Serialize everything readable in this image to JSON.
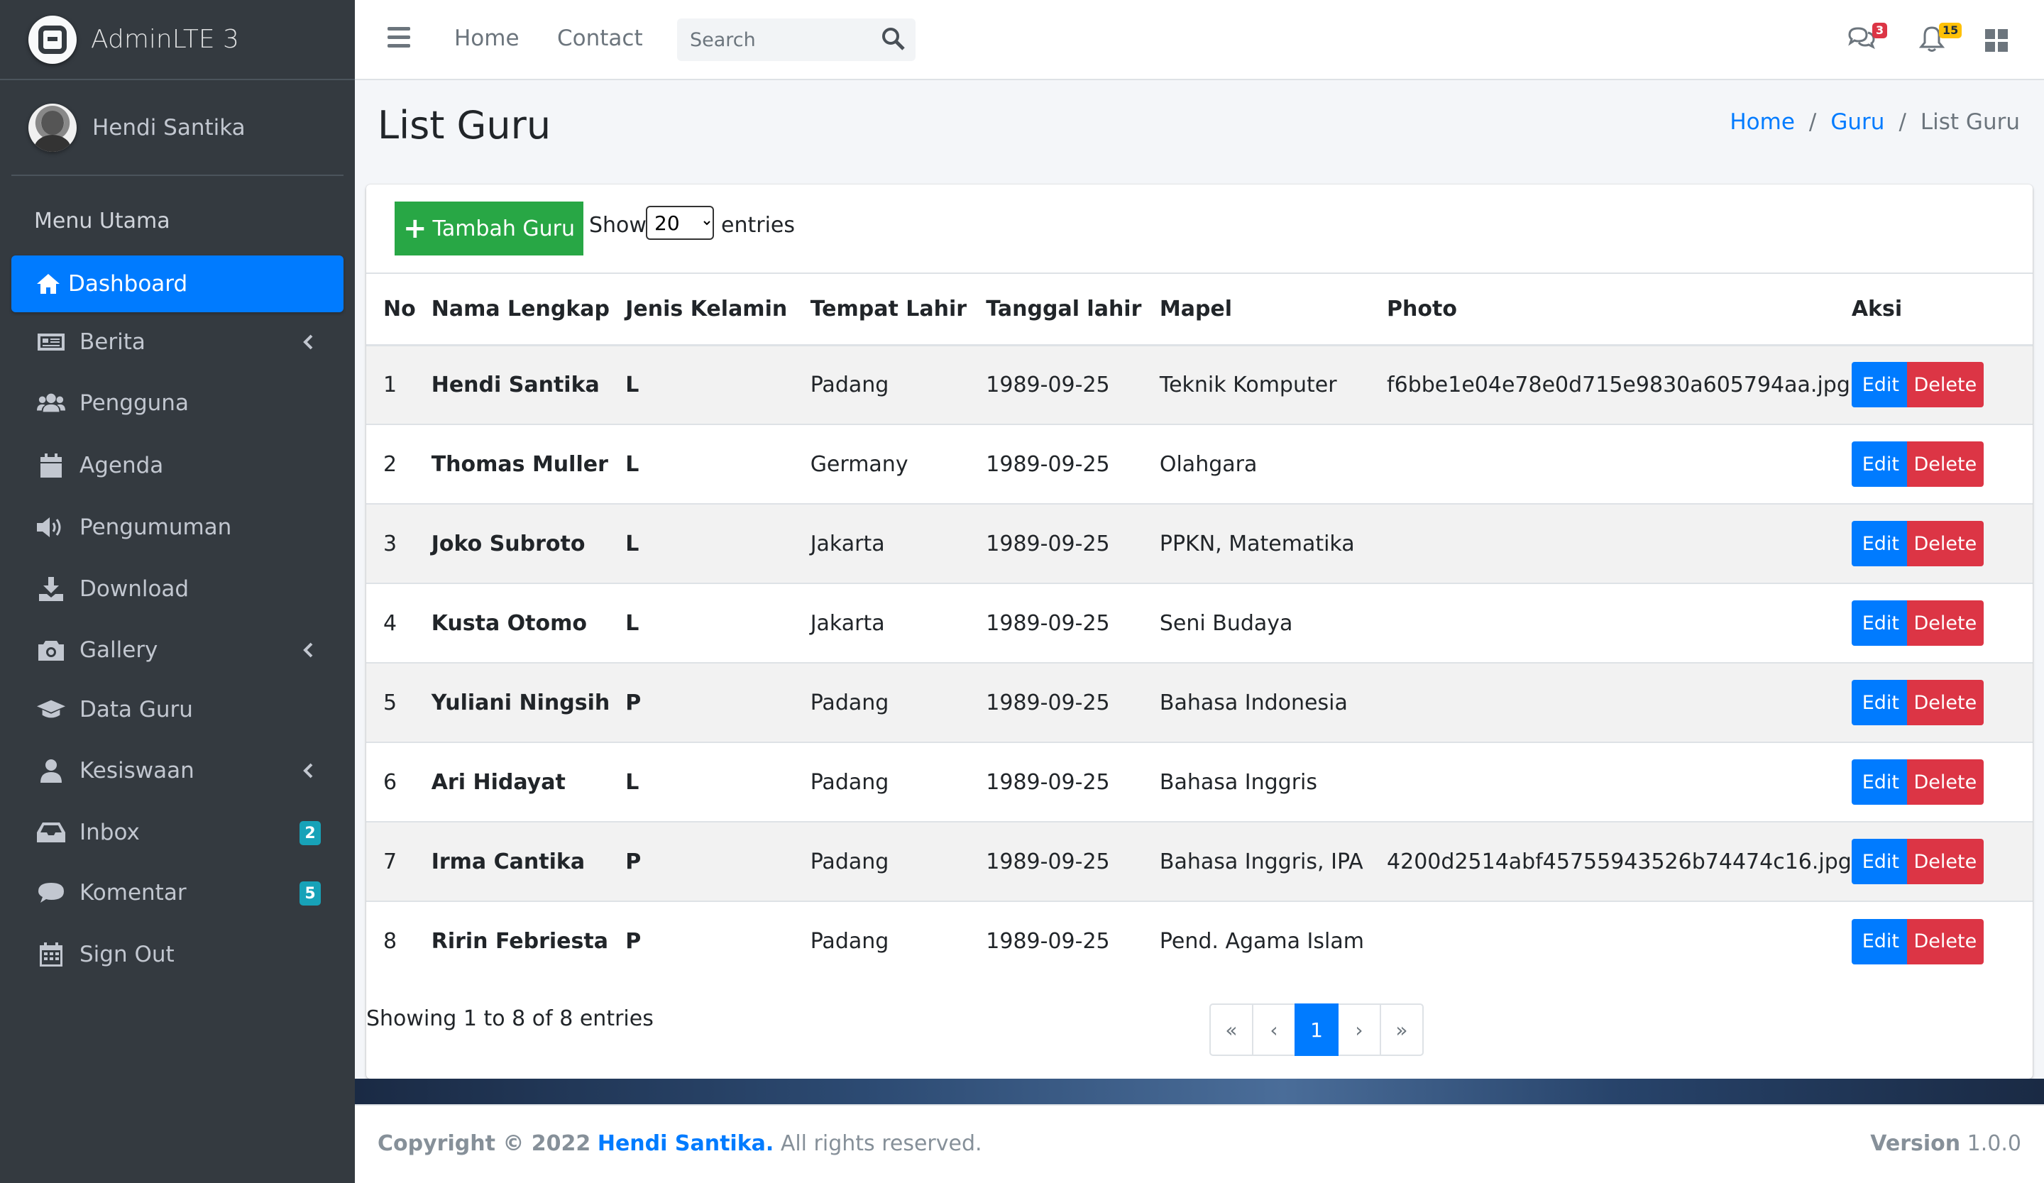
{
  "brand": {
    "name": "AdminLTE 3"
  },
  "user": {
    "name": "Hendi Santika"
  },
  "sidebar": {
    "header": "Menu Utama",
    "items": [
      {
        "label": "Dashboard",
        "icon": "home-icon"
      },
      {
        "label": "Berita",
        "icon": "newspaper-icon"
      },
      {
        "label": "Pengguna",
        "icon": "users-icon"
      },
      {
        "label": "Agenda",
        "icon": "calendar-icon"
      },
      {
        "label": "Pengumuman",
        "icon": "volume-icon"
      },
      {
        "label": "Download",
        "icon": "download-icon"
      },
      {
        "label": "Gallery",
        "icon": "camera-icon"
      },
      {
        "label": "Data Guru",
        "icon": "graduation-cap-icon"
      },
      {
        "label": "Kesiswaan",
        "icon": "user-icon"
      },
      {
        "label": "Inbox",
        "icon": "inbox-icon",
        "badge": "2"
      },
      {
        "label": "Komentar",
        "icon": "comment-icon",
        "badge": "5"
      },
      {
        "label": "Sign Out",
        "icon": "calendar-grid-icon"
      }
    ]
  },
  "topbar": {
    "home": "Home",
    "contact": "Contact",
    "search_placeholder": "Search",
    "messages_badge": "3",
    "notifications_badge": "15"
  },
  "page": {
    "title": "List Guru",
    "breadcrumb": [
      "Home",
      "Guru",
      "List Guru"
    ]
  },
  "card": {
    "add_button": "Tambah Guru",
    "show_label": "Show",
    "show_value": "20",
    "entries_label": "entries",
    "columns": [
      "No",
      "Nama Lengkap",
      "Jenis Kelamin",
      "Tempat Lahir",
      "Tanggal lahir",
      "Mapel",
      "Photo",
      "Aksi"
    ],
    "rows": [
      [
        "1",
        "Hendi Santika",
        "L",
        "Padang",
        "1989-09-25",
        "Teknik Komputer",
        "f6bbe1e04e78e0d715e9830a605794aa.jpg"
      ],
      [
        "2",
        "Thomas Muller",
        "L",
        "Germany",
        "1989-09-25",
        "Olahgara",
        ""
      ],
      [
        "3",
        "Joko Subroto",
        "L",
        "Jakarta",
        "1989-09-25",
        "PPKN, Matematika",
        ""
      ],
      [
        "4",
        "Kusta Otomo",
        "L",
        "Jakarta",
        "1989-09-25",
        "Seni Budaya",
        ""
      ],
      [
        "5",
        "Yuliani Ningsih",
        "P",
        "Padang",
        "1989-09-25",
        "Bahasa Indonesia",
        ""
      ],
      [
        "6",
        "Ari Hidayat",
        "L",
        "Padang",
        "1989-09-25",
        "Bahasa Inggris",
        ""
      ],
      [
        "7",
        "Irma Cantika",
        "P",
        "Padang",
        "1989-09-25",
        "Bahasa Inggris, IPA",
        "4200d2514abf45755943526b74474c16.jpg"
      ],
      [
        "8",
        "Ririn Febriesta",
        "P",
        "Padang",
        "1989-09-25",
        "Pend. Agama Islam",
        ""
      ]
    ],
    "edit_label": "Edit",
    "delete_label": "Delete",
    "showing": "Showing 1 to 8 of 8 entries",
    "pager": [
      "«",
      "‹",
      "1",
      "›",
      "»"
    ]
  },
  "footer": {
    "copyright_prefix": "Copyright © 2022",
    "author": "Hendi Santika.",
    "rights": "All rights reserved.",
    "version_label": "Version",
    "version": "1.0.0"
  },
  "colors": {
    "primary": "#007bff",
    "success": "#28a745",
    "danger": "#dc3545",
    "sidebar": "#343a40",
    "info": "#17a2b8",
    "warning": "#ffc107"
  }
}
